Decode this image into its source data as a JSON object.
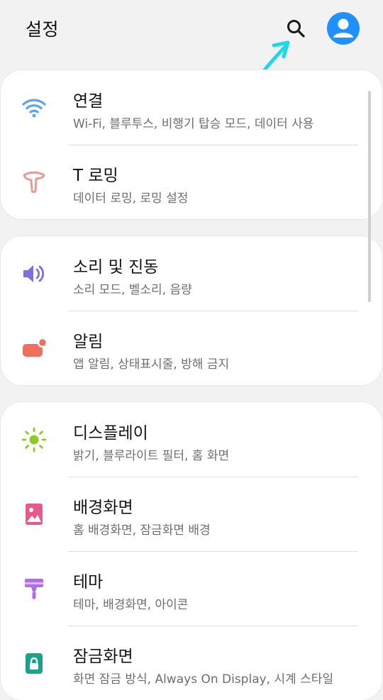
{
  "header": {
    "title": "설정",
    "search_icon": "search-icon",
    "avatar_icon": "profile-icon",
    "avatar_color": "#1e90ff"
  },
  "sections": [
    {
      "items": [
        {
          "title": "연결",
          "subtitle": "Wi-Fi, 블루투스, 비행기 탑승 모드, 데이터 사용",
          "icon": "wifi-icon",
          "color": "#5aa3f0"
        },
        {
          "title": "T 로밍",
          "subtitle": "데이터 로밍, 로밍 설정",
          "icon": "t-roaming-icon",
          "color": "#e89a9a"
        }
      ]
    },
    {
      "items": [
        {
          "title": "소리 및 진동",
          "subtitle": "소리 모드, 벨소리, 음량",
          "icon": "speaker-icon",
          "color": "#7b72e0"
        },
        {
          "title": "알림",
          "subtitle": "앱 알림, 상태표시줄, 방해 금지",
          "icon": "notification-icon",
          "color": "#ef6f5e"
        }
      ]
    },
    {
      "items": [
        {
          "title": "디스플레이",
          "subtitle": "밝기, 블루라이트 필터, 홈 화면",
          "icon": "brightness-icon",
          "color": "#8ccc2a"
        },
        {
          "title": "배경화면",
          "subtitle": "홈 배경화면, 잠금화면 배경",
          "icon": "wallpaper-icon",
          "color": "#e55a88"
        },
        {
          "title": "테마",
          "subtitle": "테마, 배경화면, 아이콘",
          "icon": "theme-brush-icon",
          "color": "#b070e0"
        },
        {
          "title": "잠금화면",
          "subtitle": "화면 잠금 방식, Always On Display, 시계 스타일",
          "icon": "lock-icon",
          "color": "#1aa38a"
        }
      ]
    }
  ]
}
